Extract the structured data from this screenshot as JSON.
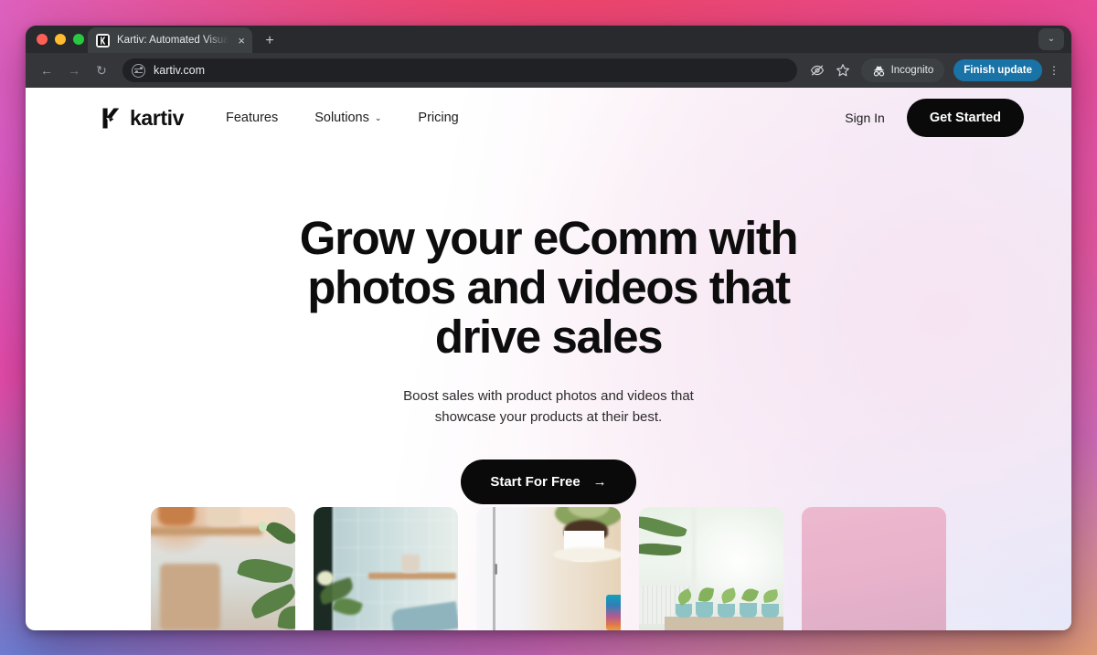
{
  "browser": {
    "traffic_lights": [
      "close",
      "minimize",
      "zoom"
    ],
    "tab": {
      "title": "Kartiv: Automated Visual Con",
      "favicon_name": "kartiv-favicon",
      "close_label": "×"
    },
    "new_tab_label": "+",
    "tab_list_chevron": "⌄",
    "toolbar": {
      "back_label": "←",
      "forward_label": "→",
      "reload_label": "↻",
      "url": "kartiv.com",
      "site_settings_icon": "tune-icon",
      "hide_password_icon": "eye-slash-icon",
      "bookmark_icon": "star-icon",
      "incognito_label": "Incognito",
      "incognito_icon": "incognito-hat-icon",
      "update_label": "Finish update",
      "menu_label": "⋮"
    }
  },
  "site": {
    "nav": {
      "brand": "kartiv",
      "brand_logo_name": "kartiv-logo",
      "links": [
        {
          "label": "Features",
          "has_chevron": false
        },
        {
          "label": "Solutions",
          "has_chevron": true,
          "chevron": "⌄"
        },
        {
          "label": "Pricing",
          "has_chevron": false
        }
      ],
      "sign_in": "Sign In",
      "get_started": "Get Started"
    },
    "hero": {
      "headline": "Grow your eComm with photos and videos that drive sales",
      "subtext": "Boost sales with product photos and videos that showcase your products at their best.",
      "cta_label": "Start For Free",
      "cta_arrow": "→"
    },
    "gallery": {
      "cards": [
        {
          "name": "plant-on-shelf-photo",
          "alt": "Green plant in front of a blurred shelf"
        },
        {
          "name": "window-shelf-mug-photo",
          "alt": "Mug on a wooden shelf by a gridded window"
        },
        {
          "name": "potted-plant-table-photo",
          "alt": "Potted plant and rainbow can on a wooden table"
        },
        {
          "name": "windowsill-plants-photo",
          "alt": "Row of teal pots on a sunny windowsill"
        },
        {
          "name": "pink-backdrop-photo",
          "alt": "Plain pink product backdrop"
        }
      ]
    }
  },
  "colors": {
    "accent_black": "#0a0a0a",
    "update_blue": "#1a73a7",
    "backdrop_pink": "#e54cab",
    "backdrop_red": "#ef4057",
    "backdrop_orange": "#e8a06a",
    "backdrop_blue": "#6d7fd4",
    "card_pink": "#edb9ce"
  }
}
